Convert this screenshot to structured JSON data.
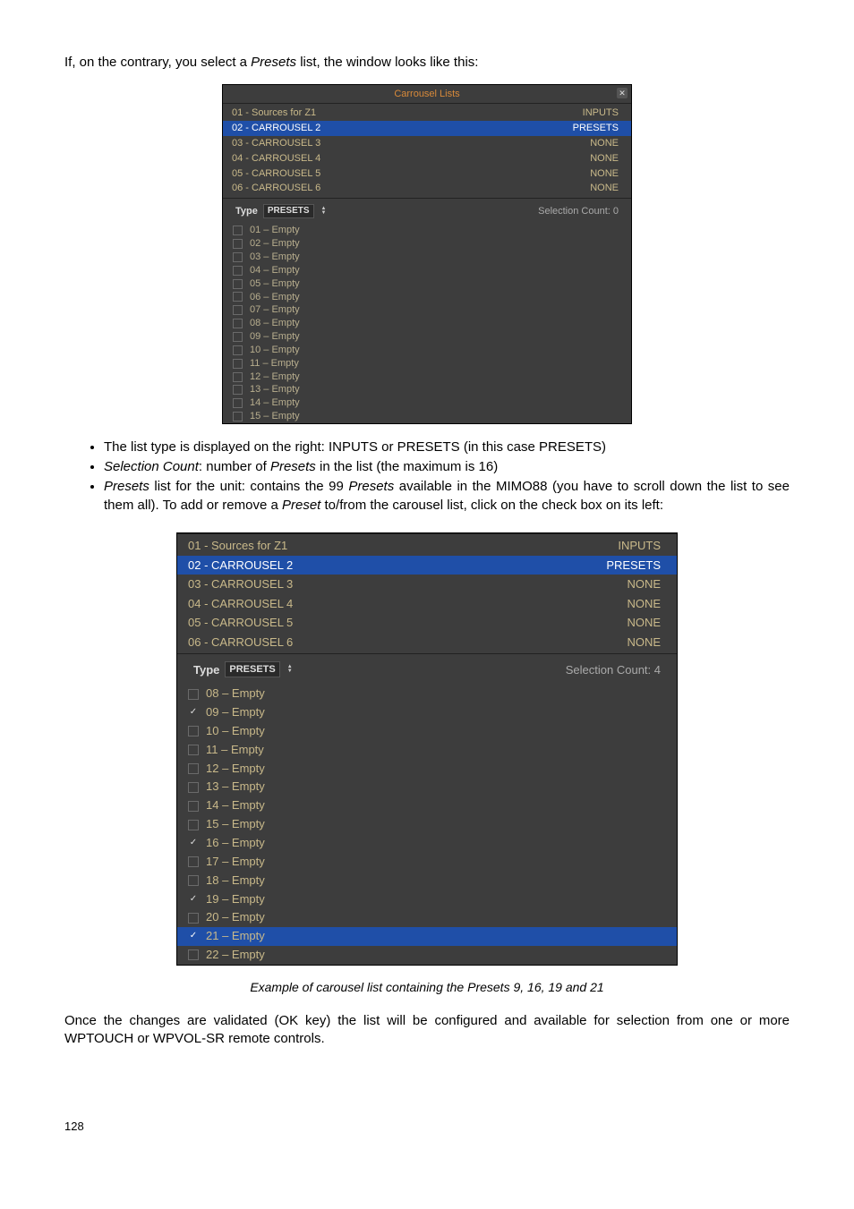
{
  "intro_text": "If, on the contrary, you select a Presets list, the window looks like this:",
  "panel_title": "Carrousel Lists",
  "close_glyph": "✕",
  "type_label": "Type",
  "type_value": "PRESETS",
  "selection_count_label_top": "Selection Count: 0",
  "selection_count_label_bottom": "Selection Count: 4",
  "carrousel_rows": [
    {
      "name": "01 - Sources for Z1",
      "rtype": "INPUTS",
      "cls": ""
    },
    {
      "name": "02 - CARROUSEL 2",
      "rtype": "PRESETS",
      "cls": "selected"
    },
    {
      "name": "03 - CARROUSEL 3",
      "rtype": "NONE",
      "cls": ""
    },
    {
      "name": "04 - CARROUSEL 4",
      "rtype": "NONE",
      "cls": ""
    },
    {
      "name": "05 - CARROUSEL 5",
      "rtype": "NONE",
      "cls": ""
    },
    {
      "name": "06 - CARROUSEL 6",
      "rtype": "NONE",
      "cls": ""
    }
  ],
  "presets_top": [
    {
      "n": "01 – Empty"
    },
    {
      "n": "02 – Empty"
    },
    {
      "n": "03 – Empty"
    },
    {
      "n": "04 – Empty"
    },
    {
      "n": "05 – Empty"
    },
    {
      "n": "06 – Empty"
    },
    {
      "n": "07 – Empty"
    },
    {
      "n": "08 – Empty"
    },
    {
      "n": "09 – Empty"
    },
    {
      "n": "10 – Empty"
    },
    {
      "n": "11 – Empty"
    },
    {
      "n": "12 – Empty"
    },
    {
      "n": "13 – Empty"
    },
    {
      "n": "14 – Empty"
    },
    {
      "n": "15 – Empty"
    }
  ],
  "bullets": {
    "b1_a": "The list type is displayed on the right: INPUTS or PRESETS (in this case PRESETS)",
    "b2_a": "Selection Count",
    "b2_b": ": number of ",
    "b2_c": "Presets",
    "b2_d": "  in the list (the maximum is 16)",
    "b3_a": "Presets",
    "b3_b": " list for the unit: contains the 99 ",
    "b3_c": "Presets",
    "b3_d": " available in the MIMO88 (you have to scroll down the list to see them all). To add or remove a ",
    "b3_e": "Preset",
    "b3_f": " to/from the carousel list, click on the check box on its left:"
  },
  "presets_bottom": [
    {
      "n": "08 – Empty",
      "checked": false,
      "sel": false
    },
    {
      "n": "09 – Empty",
      "checked": true,
      "sel": false
    },
    {
      "n": "10 – Empty",
      "checked": false,
      "sel": false
    },
    {
      "n": "11 – Empty",
      "checked": false,
      "sel": false
    },
    {
      "n": "12 – Empty",
      "checked": false,
      "sel": false
    },
    {
      "n": "13 – Empty",
      "checked": false,
      "sel": false
    },
    {
      "n": "14 – Empty",
      "checked": false,
      "sel": false
    },
    {
      "n": "15 – Empty",
      "checked": false,
      "sel": false
    },
    {
      "n": "16 – Empty",
      "checked": true,
      "sel": false
    },
    {
      "n": "17 – Empty",
      "checked": false,
      "sel": false
    },
    {
      "n": "18 – Empty",
      "checked": false,
      "sel": false
    },
    {
      "n": "19 – Empty",
      "checked": true,
      "sel": false
    },
    {
      "n": "20 – Empty",
      "checked": false,
      "sel": false
    },
    {
      "n": "21 – Empty",
      "checked": true,
      "sel": true
    },
    {
      "n": "22 – Empty",
      "checked": false,
      "sel": false
    }
  ],
  "caption": "Example of carousel list containing the Presets 9, 16, 19 and 21",
  "outro_text": "Once the changes are validated (OK key) the list will be configured and available for selection from one or more WPTOUCH or WPVOL-SR remote controls.",
  "page_number": "128"
}
